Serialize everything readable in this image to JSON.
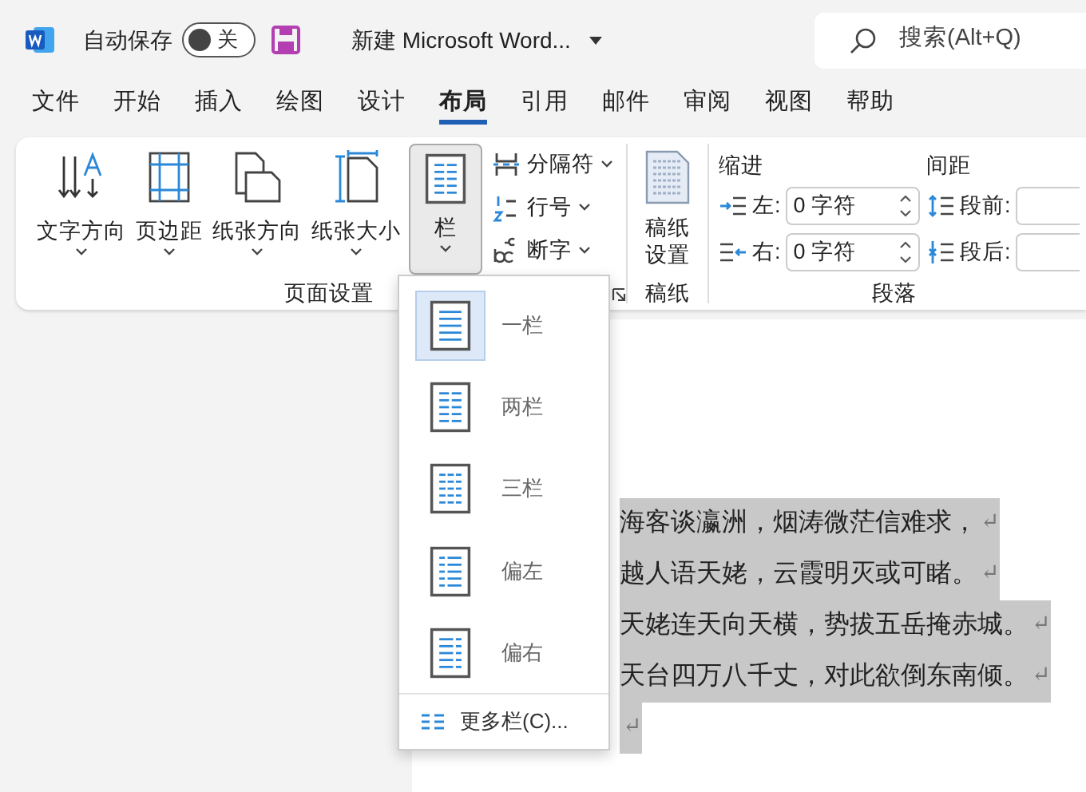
{
  "title_bar": {
    "autosave_label": "自动保存",
    "autosave_toggle": {
      "on": false,
      "label": "关"
    },
    "document_title": "新建 Microsoft Word...",
    "search": {
      "placeholder": "搜索(Alt+Q)"
    }
  },
  "tabs": [
    {
      "label": "文件",
      "selected": false
    },
    {
      "label": "开始",
      "selected": false
    },
    {
      "label": "插入",
      "selected": false
    },
    {
      "label": "绘图",
      "selected": false
    },
    {
      "label": "设计",
      "selected": false
    },
    {
      "label": "布局",
      "selected": true
    },
    {
      "label": "引用",
      "selected": false
    },
    {
      "label": "邮件",
      "selected": false
    },
    {
      "label": "审阅",
      "selected": false
    },
    {
      "label": "视图",
      "selected": false
    },
    {
      "label": "帮助",
      "selected": false
    }
  ],
  "ribbon": {
    "page_setup": {
      "label": "页面设置",
      "big_buttons": [
        {
          "label": "文字方向",
          "kind": "direction"
        },
        {
          "label": "页边距",
          "kind": "margins"
        },
        {
          "label": "纸张方向",
          "kind": "orientation"
        },
        {
          "label": "纸张大小",
          "kind": "size"
        }
      ],
      "columns_button": {
        "label": "栏",
        "pressed": true
      },
      "small_buttons": [
        {
          "label": "分隔符",
          "kind": "breaks"
        },
        {
          "label": "行号",
          "kind": "numbers"
        },
        {
          "label": "断字",
          "kind": "hyphen"
        }
      ]
    },
    "manuscript": {
      "label": "稿纸",
      "button_lines": [
        "稿纸",
        "设置"
      ]
    },
    "paragraph": {
      "label": "段落",
      "indent": {
        "heading": "缩进",
        "rows": [
          {
            "label": "左:",
            "value": "0 字符",
            "kind": "left"
          },
          {
            "label": "右:",
            "value": "0 字符",
            "kind": "right"
          }
        ]
      },
      "spacing": {
        "heading": "间距",
        "rows": [
          {
            "label": "段前:",
            "kind": "before"
          },
          {
            "label": "段后:",
            "kind": "after"
          }
        ]
      }
    }
  },
  "columns_menu": {
    "items": [
      {
        "label": "一栏",
        "kind": "one",
        "selected": true
      },
      {
        "label": "两栏",
        "kind": "two",
        "selected": false
      },
      {
        "label": "三栏",
        "kind": "three",
        "selected": false
      },
      {
        "label": "偏左",
        "kind": "left",
        "selected": false
      },
      {
        "label": "偏右",
        "kind": "right",
        "selected": false
      }
    ],
    "more": "更多栏(C)..."
  },
  "document": {
    "selected": true,
    "lines": [
      {
        "text": "海客谈瀛洲，烟涛微茫信难求，",
        "mark": "↵"
      },
      {
        "text": "越人语天姥，云霞明灭或可睹。",
        "mark": "↵"
      },
      {
        "text": "天姥连天向天横，势拔五岳掩赤城。",
        "mark": "↵"
      },
      {
        "text": "天台四万八千丈，对此欲倒东南倾。",
        "mark": "↵"
      },
      {
        "mark": "↵"
      }
    ]
  }
}
